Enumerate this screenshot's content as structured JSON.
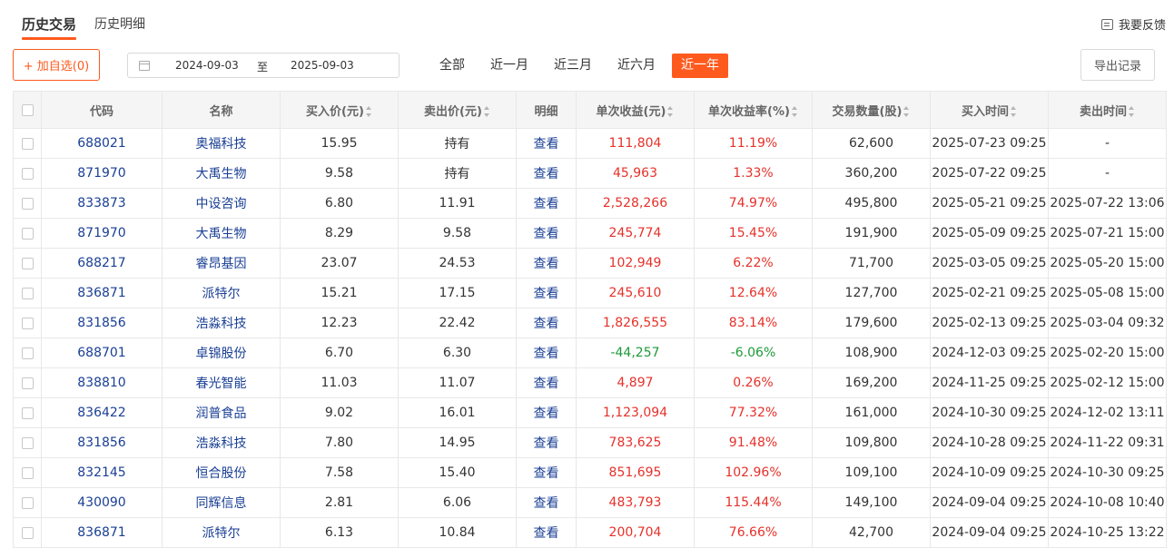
{
  "tabs": [
    {
      "label": "历史交易",
      "active": true
    },
    {
      "label": "历史明细",
      "active": false
    }
  ],
  "feedback_label": "我要反馈",
  "toolbar": {
    "add_watch_label": "+ 加自选(0)",
    "date_start": "2024-09-03",
    "date_separator": "至",
    "date_end": "2025-09-03",
    "periods": [
      "全部",
      "近一月",
      "近三月",
      "近六月",
      "近一年"
    ],
    "active_period": "近一年",
    "export_label": "导出记录"
  },
  "colors": {
    "accent": "#ff5a1e",
    "gain": "#e5312a",
    "loss": "#1f9a3a",
    "link": "#1a3f94"
  },
  "table": {
    "headers": [
      "代码",
      "名称",
      "买入价(元)",
      "卖出价(元)",
      "明细",
      "单次收益(元)",
      "单次收益率(%)",
      "交易数量(股)",
      "买入时间",
      "卖出时间"
    ],
    "rows": [
      {
        "code": "688021",
        "name": "奥福科技",
        "buy": "15.95",
        "sell": "持有",
        "detail": "查看",
        "profit": "111,804",
        "rate": "11.19%",
        "qty": "62,600",
        "buy_time": "2025-07-23 09:25",
        "sell_time": "-"
      },
      {
        "code": "871970",
        "name": "大禹生物",
        "buy": "9.58",
        "sell": "持有",
        "detail": "查看",
        "profit": "45,963",
        "rate": "1.33%",
        "qty": "360,200",
        "buy_time": "2025-07-22 09:25",
        "sell_time": "-"
      },
      {
        "code": "833873",
        "name": "中设咨询",
        "buy": "6.80",
        "sell": "11.91",
        "detail": "查看",
        "profit": "2,528,266",
        "rate": "74.97%",
        "qty": "495,800",
        "buy_time": "2025-05-21 09:25",
        "sell_time": "2025-07-22 13:06"
      },
      {
        "code": "871970",
        "name": "大禹生物",
        "buy": "8.29",
        "sell": "9.58",
        "detail": "查看",
        "profit": "245,774",
        "rate": "15.45%",
        "qty": "191,900",
        "buy_time": "2025-05-09 09:25",
        "sell_time": "2025-07-21 15:00"
      },
      {
        "code": "688217",
        "name": "睿昂基因",
        "buy": "23.07",
        "sell": "24.53",
        "detail": "查看",
        "profit": "102,949",
        "rate": "6.22%",
        "qty": "71,700",
        "buy_time": "2025-03-05 09:25",
        "sell_time": "2025-05-20 15:00"
      },
      {
        "code": "836871",
        "name": "派特尔",
        "buy": "15.21",
        "sell": "17.15",
        "detail": "查看",
        "profit": "245,610",
        "rate": "12.64%",
        "qty": "127,700",
        "buy_time": "2025-02-21 09:25",
        "sell_time": "2025-05-08 15:00"
      },
      {
        "code": "831856",
        "name": "浩淼科技",
        "buy": "12.23",
        "sell": "22.42",
        "detail": "查看",
        "profit": "1,826,555",
        "rate": "83.14%",
        "qty": "179,600",
        "buy_time": "2025-02-13 09:25",
        "sell_time": "2025-03-04 09:32"
      },
      {
        "code": "688701",
        "name": "卓锦股份",
        "buy": "6.70",
        "sell": "6.30",
        "detail": "查看",
        "profit": "-44,257",
        "rate": "-6.06%",
        "qty": "108,900",
        "buy_time": "2024-12-03 09:25",
        "sell_time": "2025-02-20 15:00"
      },
      {
        "code": "838810",
        "name": "春光智能",
        "buy": "11.03",
        "sell": "11.07",
        "detail": "查看",
        "profit": "4,897",
        "rate": "0.26%",
        "qty": "169,200",
        "buy_time": "2024-11-25 09:25",
        "sell_time": "2025-02-12 15:00"
      },
      {
        "code": "836422",
        "name": "润普食品",
        "buy": "9.02",
        "sell": "16.01",
        "detail": "查看",
        "profit": "1,123,094",
        "rate": "77.32%",
        "qty": "161,000",
        "buy_time": "2024-10-30 09:25",
        "sell_time": "2024-12-02 13:11"
      },
      {
        "code": "831856",
        "name": "浩淼科技",
        "buy": "7.80",
        "sell": "14.95",
        "detail": "查看",
        "profit": "783,625",
        "rate": "91.48%",
        "qty": "109,800",
        "buy_time": "2024-10-28 09:25",
        "sell_time": "2024-11-22 09:31"
      },
      {
        "code": "832145",
        "name": "恒合股份",
        "buy": "7.58",
        "sell": "15.40",
        "detail": "查看",
        "profit": "851,695",
        "rate": "102.96%",
        "qty": "109,100",
        "buy_time": "2024-10-09 09:25",
        "sell_time": "2024-10-30 09:25"
      },
      {
        "code": "430090",
        "name": "同辉信息",
        "buy": "2.81",
        "sell": "6.06",
        "detail": "查看",
        "profit": "483,793",
        "rate": "115.44%",
        "qty": "149,100",
        "buy_time": "2024-09-04 09:25",
        "sell_time": "2024-10-08 10:40"
      },
      {
        "code": "836871",
        "name": "派特尔",
        "buy": "6.13",
        "sell": "10.84",
        "detail": "查看",
        "profit": "200,704",
        "rate": "76.66%",
        "qty": "42,700",
        "buy_time": "2024-09-04 09:25",
        "sell_time": "2024-10-25 13:22"
      }
    ]
  }
}
